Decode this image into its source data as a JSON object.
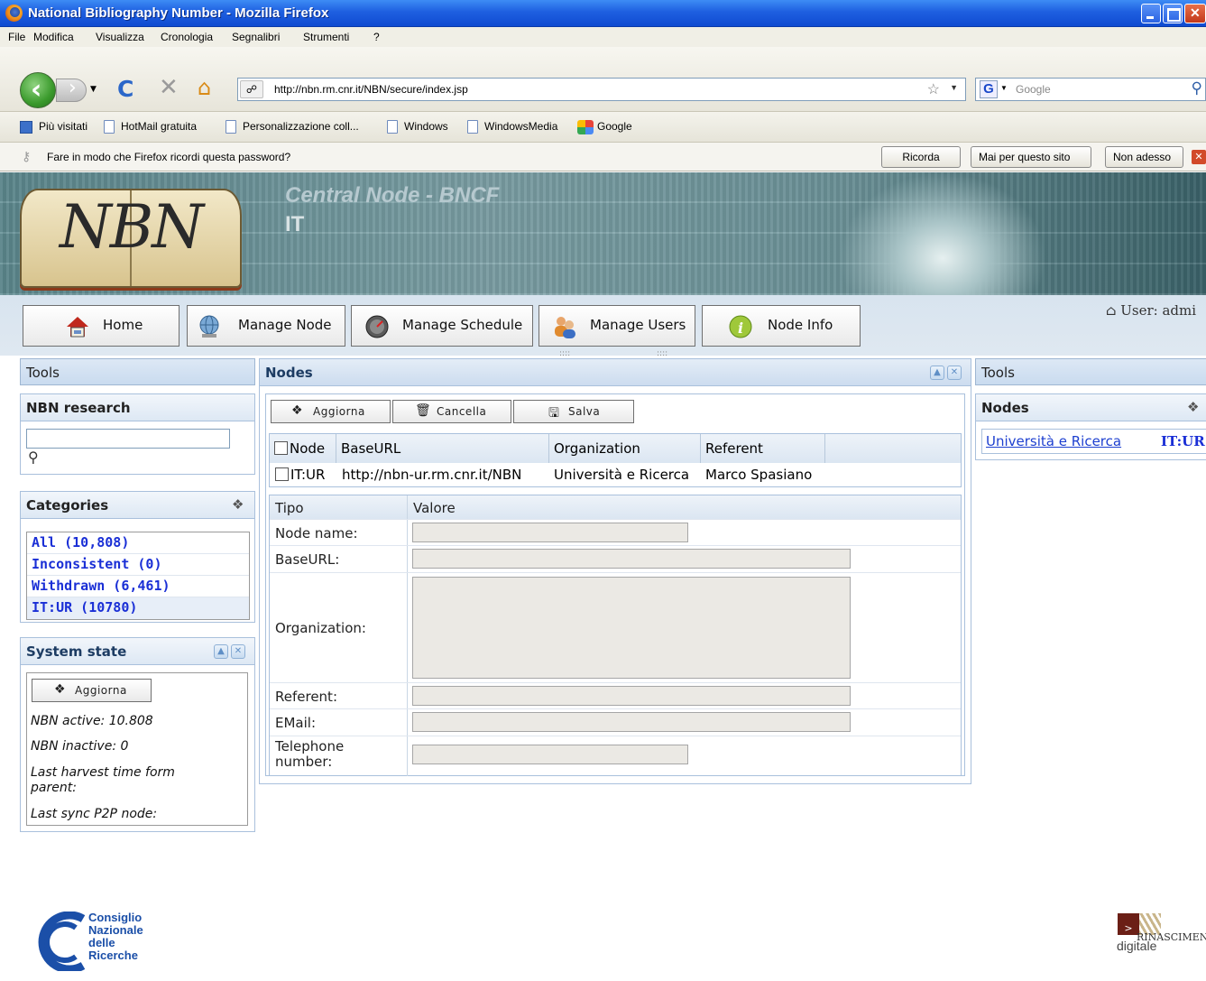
{
  "window": {
    "title": "National Bibliography Number - Mozilla Firefox"
  },
  "menu": [
    "File",
    "Modifica",
    "Visualizza",
    "Cronologia",
    "Segnalibri",
    "Strumenti",
    "?"
  ],
  "url": "http://nbn.rm.cnr.it/NBN/secure/index.jsp",
  "search_placeholder": "Google",
  "bookmarks": [
    "Più visitati",
    "HotMail gratuita",
    "Personalizzazione coll...",
    "Windows",
    "WindowsMedia",
    "Google"
  ],
  "password_bar": {
    "message": "Fare in modo che Firefox ricordi questa password?",
    "buttons": [
      "Ricorda",
      "Mai per questo sito",
      "Non adesso"
    ]
  },
  "header": {
    "title": "Central Node - BNCF",
    "code": "IT",
    "logo_text": "NBN"
  },
  "nav_buttons": [
    "Home",
    "Manage Node",
    "Manage Schedule",
    "Manage Users",
    "Node Info"
  ],
  "user_label": "User: admi",
  "left": {
    "tools_label": "Tools",
    "research_title": "NBN research",
    "search_value": "",
    "categories_title": "Categories",
    "categories": [
      "All (10,808)",
      "Inconsistent (0)",
      "Withdrawn (6,461)",
      "IT:UR (10780)"
    ],
    "system_title": "System state",
    "refresh_label": "Aggiorna",
    "lines": [
      "NBN active: 10.808",
      "NBN inactive: 0",
      "Last harvest time form parent:",
      "Last sync P2P node:"
    ]
  },
  "center": {
    "title": "Nodes",
    "toolbar": [
      "Aggiorna",
      "Cancella",
      "Salva"
    ],
    "columns": [
      "Node",
      "BaseURL",
      "Organization",
      "Referent"
    ],
    "rows": [
      {
        "node": "IT:UR",
        "baseurl": "http://nbn-ur.rm.cnr.it/NBN",
        "organization": "Università e Ricerca",
        "referent": "Marco Spasiano"
      }
    ],
    "form_headers": [
      "Tipo",
      "Valore"
    ],
    "fields": [
      "Node name:",
      "BaseURL:",
      "Organization:",
      "Referent:",
      "EMail:",
      "Telephone number:"
    ]
  },
  "right": {
    "tools_label": "Tools",
    "nodes_title": "Nodes",
    "link": "Università e Ricerca",
    "code": "IT:UR"
  },
  "footer": {
    "cnr": [
      "Consiglio",
      "Nazionale",
      "delle",
      "Ricerche"
    ],
    "rinascimento": "RINASCIMENTO",
    "digitale": "digitale"
  }
}
